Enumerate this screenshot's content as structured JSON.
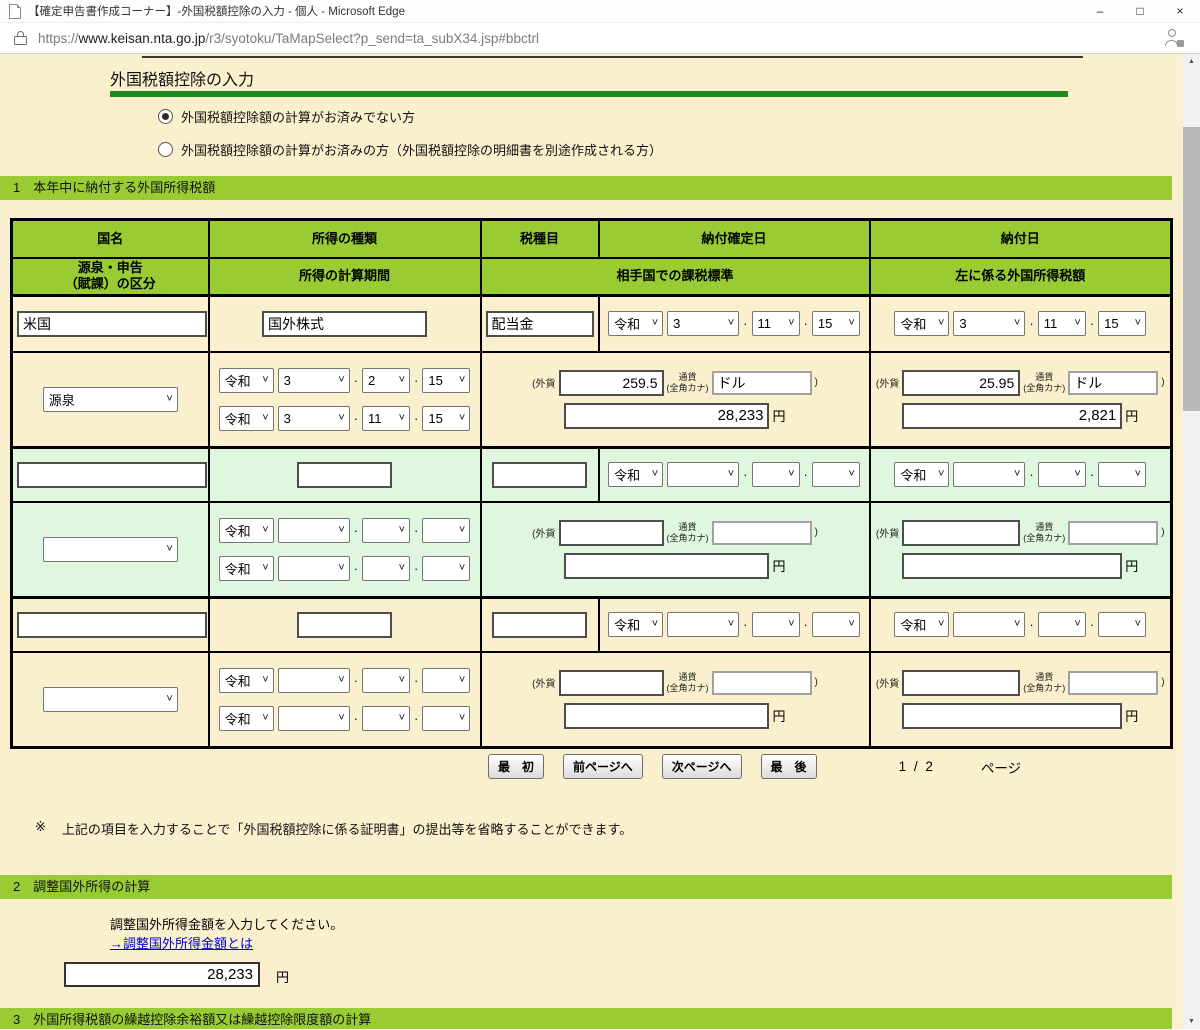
{
  "browser": {
    "window_title": "【確定申告書作成コーナー】-外国税額控除の入力 - 個人 - Microsoft Edge",
    "url_scheme": "https://",
    "url_host": "www.keisan.nta.go.jp",
    "url_path": "/r3/syotoku/TaMapSelect?p_send=ta_subX34.jsp#bbctrl",
    "minimize_glyph": "–",
    "maximize_glyph": "□",
    "close_glyph": "×"
  },
  "labels": {
    "foreign_open": "(外貨",
    "currency_top": "通貨",
    "currency_bottom": "(全角カナ)",
    "paren_close": ")",
    "yen": "円",
    "dot": "·",
    "chevron": "˅",
    "note_mark": "※",
    "scroll_up": "▲",
    "scroll_down": "▼"
  },
  "page": {
    "title": "外国税額控除の入力",
    "radios": [
      {
        "label": "外国税額控除額の計算がお済みでない方",
        "checked": true
      },
      {
        "label": "外国税額控除額の計算がお済みの方（外国税額控除の明細書を別途作成される方）",
        "checked": false
      }
    ],
    "section1": {
      "heading": "1　本年中に納付する外国所得税額",
      "headers": {
        "country": "国名",
        "income_type": "所得の種類",
        "tax_item": "税種目",
        "due_date": "納付確定日",
        "paid_date": "納付日",
        "category_line1": "源泉・申告",
        "category_line2": "（賦課）の区分",
        "period": "所得の計算期間",
        "tax_base": "相手国での課税標準",
        "tax_amount": "左に係る外国所得税額"
      },
      "entries": [
        {
          "country": "米国",
          "income_type": "国外株式",
          "tax_item": "配当金",
          "due": {
            "era": "令和",
            "y": "3",
            "m": "11",
            "d": "15"
          },
          "paid": {
            "era": "令和",
            "y": "3",
            "m": "11",
            "d": "15"
          },
          "category": "源泉",
          "p1": {
            "era": "令和",
            "y": "3",
            "m": "2",
            "d": "15"
          },
          "p2": {
            "era": "令和",
            "y": "3",
            "m": "11",
            "d": "15"
          },
          "base_foreign": "259.5",
          "base_currency": "ドル",
          "base_yen": "28,233",
          "tax_foreign": "25.95",
          "tax_currency": "ドル",
          "tax_yen": "2,821"
        },
        {
          "country": "",
          "income_type": "",
          "tax_item": "",
          "due": {
            "era": "令和",
            "y": "",
            "m": "",
            "d": ""
          },
          "paid": {
            "era": "令和",
            "y": "",
            "m": "",
            "d": ""
          },
          "category": "",
          "p1": {
            "era": "令和",
            "y": "",
            "m": "",
            "d": ""
          },
          "p2": {
            "era": "令和",
            "y": "",
            "m": "",
            "d": ""
          },
          "base_foreign": "",
          "base_currency": "",
          "base_yen": "",
          "tax_foreign": "",
          "tax_currency": "",
          "tax_yen": ""
        },
        {
          "country": "",
          "income_type": "",
          "tax_item": "",
          "due": {
            "era": "令和",
            "y": "",
            "m": "",
            "d": ""
          },
          "paid": {
            "era": "令和",
            "y": "",
            "m": "",
            "d": ""
          },
          "category": "",
          "p1": {
            "era": "令和",
            "y": "",
            "m": "",
            "d": ""
          },
          "p2": {
            "era": "令和",
            "y": "",
            "m": "",
            "d": ""
          },
          "base_foreign": "",
          "base_currency": "",
          "base_yen": "",
          "tax_foreign": "",
          "tax_currency": "",
          "tax_yen": ""
        }
      ],
      "pagination": {
        "first": "最　初",
        "prev": "前ページへ",
        "next": "次ページへ",
        "last": "最　後",
        "info": "1 /  2",
        "page_label": "ページ"
      },
      "note": "上記の項目を入力することで「外国税額控除に係る証明書」の提出等を省略することができます。"
    },
    "section2": {
      "heading": "2　調整国外所得の計算",
      "instruction": "調整国外所得金額を入力してください。",
      "link": "→調整国外所得金額とは",
      "amount": "28,233"
    },
    "section3": {
      "heading": "3　外国所得税額の繰越控除余裕額又は繰越控除限度額の計算"
    },
    "colors": {
      "section_green": "#99cc33",
      "row_green": "#dff6df",
      "page_beige": "#faf0cd",
      "title_underline_green": "#1e8b1e",
      "link_blue": "#0000dd"
    }
  }
}
